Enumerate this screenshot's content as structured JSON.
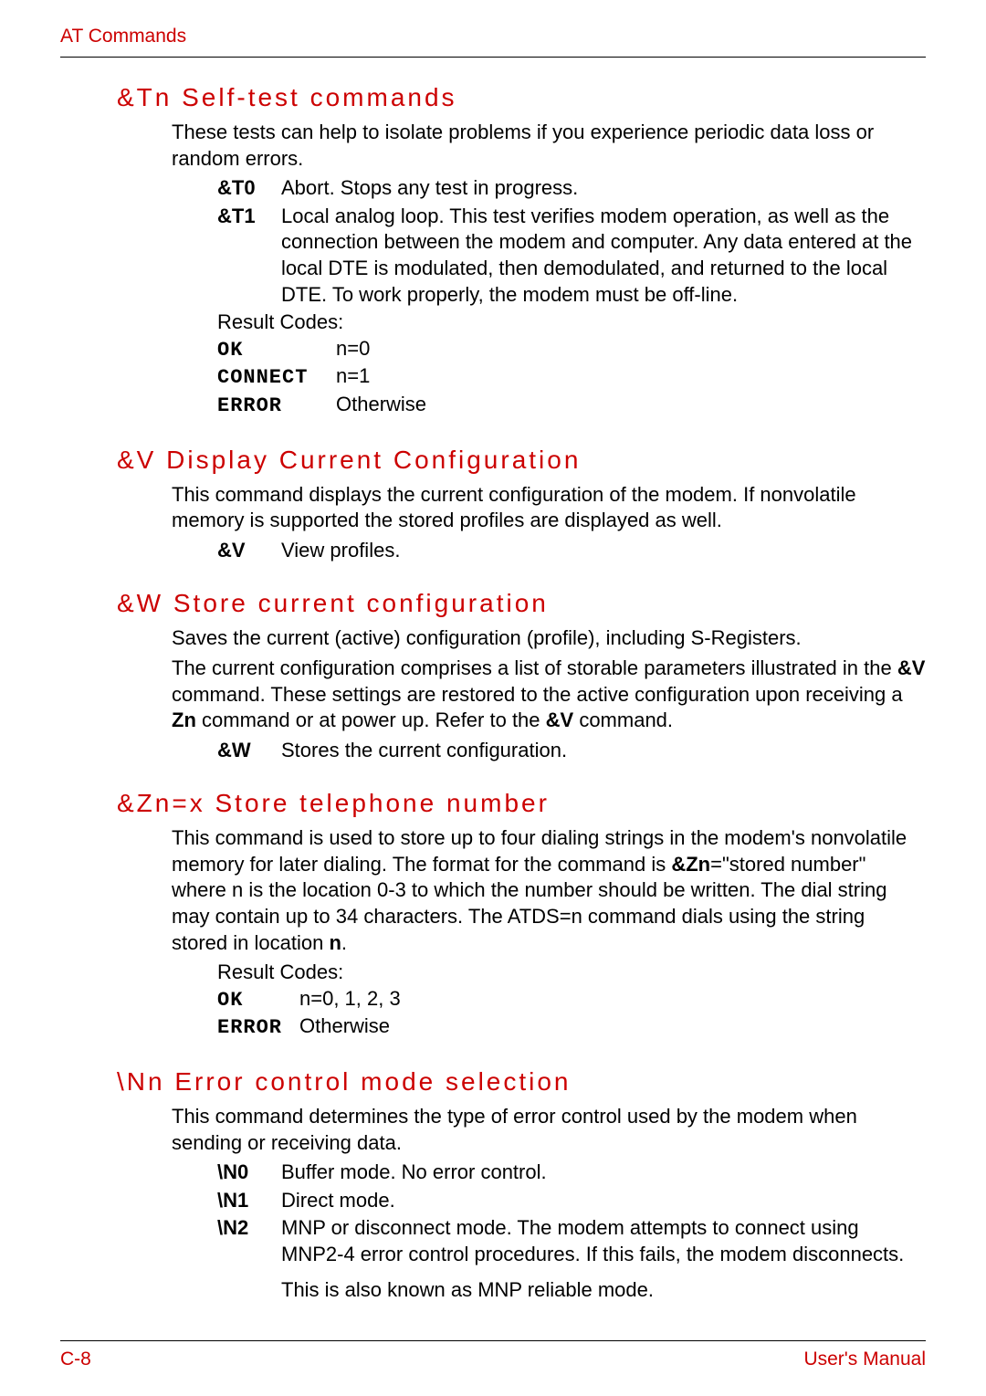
{
  "header": "AT Commands",
  "footer_left": "C-8",
  "footer_right": "User's Manual",
  "sections": {
    "tn": {
      "heading": "&Tn   Self-test commands",
      "intro": "These tests can help to isolate problems if you experience periodic data loss or random errors.",
      "items": {
        "t0_cmd": "&T0",
        "t0_txt": "Abort. Stops any test in progress.",
        "t1_cmd": "&T1",
        "t1_txt": "Local analog loop. This test verifies modem operation, as well as the connection between the modem and computer. Any data entered at the local DTE is modulated, then demodulated, and returned to the local DTE. To work properly, the modem must be off-line."
      },
      "rc_label": "Result Codes:",
      "rc": {
        "ok": "OK",
        "ok_val": "n=0",
        "connect": "CONNECT",
        "connect_val": "n=1",
        "error": "ERROR",
        "error_val": "Otherwise"
      }
    },
    "v": {
      "heading": "&V    Display Current Configuration",
      "intro": "This command displays the current configuration of the modem. If nonvolatile memory is supported the stored profiles are displayed as well.",
      "cmd": "&V",
      "txt": "View profiles."
    },
    "w": {
      "heading": "&W   Store current configuration",
      "intro1": "Saves the current (active) configuration (profile), including S-Registers.",
      "intro2_a": "The current configuration comprises a list of storable parameters illustrated in the ",
      "intro2_b": "&V",
      "intro2_c": " command. These settings are restored to the active configuration upon receiving a ",
      "intro2_d": "Zn",
      "intro2_e": " command or at power up. Refer to the ",
      "intro2_f": "&V",
      "intro2_g": " command.",
      "cmd": "&W",
      "txt": "Stores the current configuration."
    },
    "zn": {
      "heading": "&Zn=x   Store telephone number",
      "intro_a": "This command is used to store up to four dialing strings in the modem's nonvolatile memory for later dialing. The format for the command is ",
      "intro_b": "&Zn",
      "intro_c": "=\"stored number\" where n is the location 0-3 to which the number should be written. The dial string may contain up to 34 characters. The ATDS=n command dials using the string stored in location ",
      "intro_d": "n",
      "intro_e": ".",
      "rc_label": "Result Codes:",
      "rc": {
        "ok": "OK",
        "ok_val": "n=0, 1, 2, 3",
        "error": "ERROR",
        "error_val": "Otherwise"
      }
    },
    "nn": {
      "heading": "\\Nn    Error control mode selection",
      "intro": "This command determines the type of error control used by the modem when sending or receiving data.",
      "items": {
        "n0_cmd": "\\N0",
        "n0_txt": "Buffer mode. No error control.",
        "n1_cmd": "\\N1",
        "n1_txt": "Direct mode.",
        "n2_cmd": "\\N2",
        "n2_txt": "MNP or disconnect mode. The modem attempts to connect using MNP2-4 error control procedures. If this fails, the modem disconnects.",
        "n2_note": "This is also known as MNP reliable mode."
      }
    }
  }
}
